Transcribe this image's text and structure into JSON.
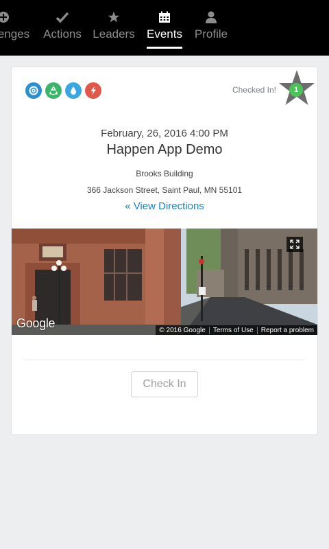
{
  "nav": {
    "tabs": [
      {
        "label": "enges",
        "icon": "plus-circle-icon",
        "active": false
      },
      {
        "label": "Actions",
        "icon": "checkmark-icon",
        "active": false
      },
      {
        "label": "Leaders",
        "icon": "star-icon",
        "active": false
      },
      {
        "label": "Events",
        "icon": "calendar-icon",
        "active": true
      },
      {
        "label": "Profile",
        "icon": "user-icon",
        "active": false
      }
    ]
  },
  "event": {
    "category_icons": [
      {
        "name": "target-icon",
        "color": "#2b8fd0"
      },
      {
        "name": "recycle-icon",
        "color": "#3cb46a"
      },
      {
        "name": "water-drop-icon",
        "color": "#3aa6e3"
      },
      {
        "name": "lightning-icon",
        "color": "#e0584a"
      }
    ],
    "checked_in_text": "Checked In!",
    "checkin_count": "1",
    "date": "February, 26, 2016 4:00 PM",
    "title": "Happen App Demo",
    "venue": "Brooks Building",
    "address": "366 Jackson Street, Saint Paul, MN 55101",
    "directions_label": "« View Directions",
    "map": {
      "logo": "Google",
      "copyright": "© 2016 Google",
      "terms": "Terms of Use",
      "report": "Report a problem"
    },
    "checkin_button": "Check In"
  },
  "colors": {
    "accent": "#1a82c4",
    "nav_bg": "#000000",
    "badge_green": "#4cc35a",
    "star_gray": "#6d6d6d"
  }
}
